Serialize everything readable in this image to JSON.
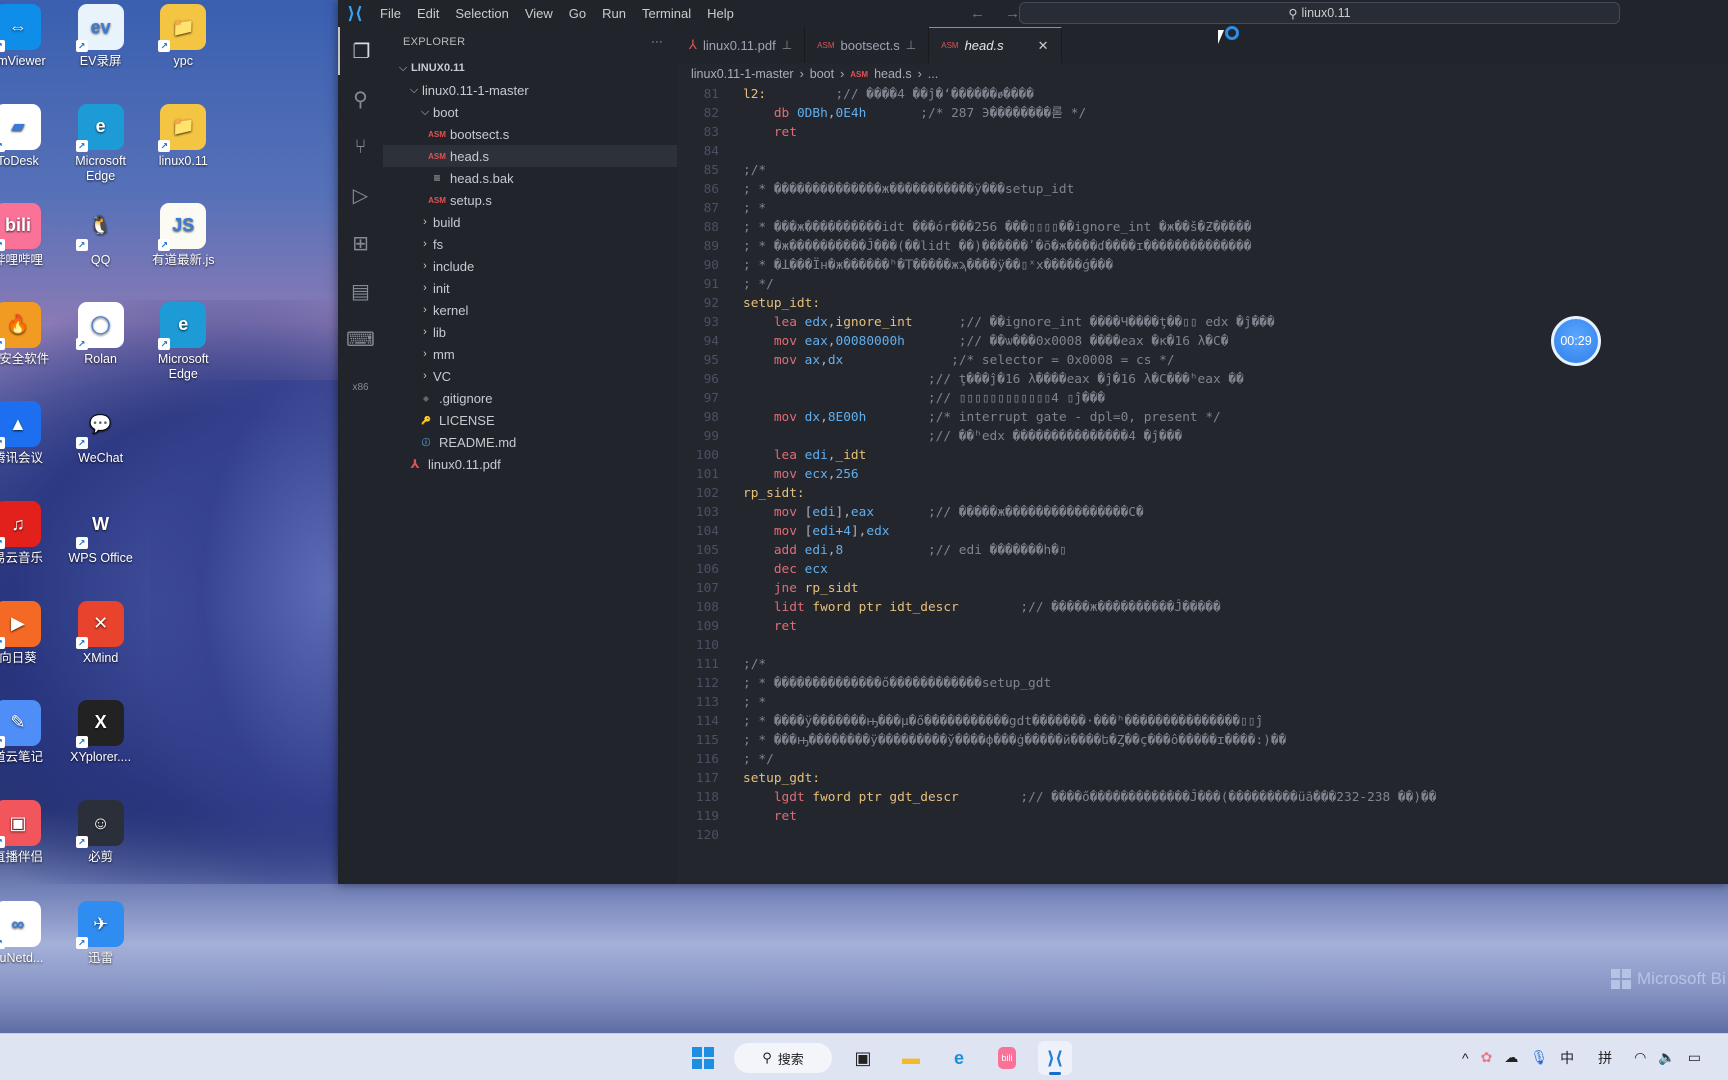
{
  "desktop": {
    "icons": [
      {
        "label": "amViewer",
        "glyph": "⇔",
        "bg": "#0e8ee9",
        "col": 0,
        "row": 0
      },
      {
        "label": "EV录屏",
        "glyph": "ev",
        "bg": "#e9f3fb",
        "col": 1,
        "row": 0
      },
      {
        "label": "ypc",
        "glyph": "📁",
        "bg": "#f4c542",
        "col": 2,
        "row": 0
      },
      {
        "label": "ToDesk",
        "glyph": "▰",
        "bg": "#ffffff",
        "col": 0,
        "row": 1
      },
      {
        "label": "Microsoft Edge",
        "glyph": "e",
        "bg": "#1d9bd7",
        "col": 1,
        "row": 1
      },
      {
        "label": "linux0.11",
        "glyph": "📁",
        "bg": "#f4c542",
        "col": 2,
        "row": 1
      },
      {
        "label": "哔哩哔哩",
        "glyph": "bili",
        "bg": "#fb7299",
        "col": 0,
        "row": 2
      },
      {
        "label": "QQ",
        "glyph": "🐧",
        "bg": "transparent",
        "col": 1,
        "row": 2
      },
      {
        "label": "有道最新.js",
        "glyph": "JS",
        "bg": "#fbfbf3",
        "col": 2,
        "row": 2
      },
      {
        "label": "戒安全软件",
        "glyph": "🔥",
        "bg": "#f29b22",
        "col": 0,
        "row": 3
      },
      {
        "label": "Rolan",
        "glyph": "◯",
        "bg": "#ffffff",
        "col": 1,
        "row": 3
      },
      {
        "label": "Microsoft Edge",
        "glyph": "e",
        "bg": "#1d9bd7",
        "col": 2,
        "row": 3
      },
      {
        "label": "腾讯会议",
        "glyph": "▲",
        "bg": "#1e6ff0",
        "col": 0,
        "row": 4
      },
      {
        "label": "WeChat",
        "glyph": "💬",
        "bg": "transparent",
        "col": 1,
        "row": 4
      },
      {
        "label": "易云音乐",
        "glyph": "♫",
        "bg": "#e2211c",
        "col": 0,
        "row": 5
      },
      {
        "label": "WPS Office",
        "glyph": "W",
        "bg": "transparent",
        "col": 1,
        "row": 5
      },
      {
        "label": "向日葵",
        "glyph": "▶",
        "bg": "#f46a24",
        "col": 0,
        "row": 6
      },
      {
        "label": "XMind",
        "glyph": "✕",
        "bg": "#e8432c",
        "col": 1,
        "row": 6
      },
      {
        "label": "道云笔记",
        "glyph": "✎",
        "bg": "#4f8ef7",
        "col": 0,
        "row": 7
      },
      {
        "label": "XYplorer....",
        "glyph": "X",
        "bg": "#222222",
        "col": 1,
        "row": 7
      },
      {
        "label": "直播伴侣",
        "glyph": "▣",
        "bg": "#f2565c",
        "col": 0,
        "row": 8
      },
      {
        "label": "必剪",
        "glyph": "☺",
        "bg": "#2b2f3a",
        "col": 1,
        "row": 8
      },
      {
        "label": "duNetd...",
        "glyph": "∞",
        "bg": "#ffffff",
        "col": 0,
        "row": 9
      },
      {
        "label": "迅雷",
        "glyph": "✈",
        "bg": "#2f8cf0",
        "col": 1,
        "row": 9
      }
    ],
    "watermark": "Microsoft Bi"
  },
  "vscode": {
    "menu": [
      "File",
      "Edit",
      "Selection",
      "View",
      "Go",
      "Run",
      "Terminal",
      "Help"
    ],
    "nav_arrows": "← →",
    "command_center": "linux0.11",
    "activity_bar": [
      "explorer-icon",
      "search-icon",
      "source-control-icon",
      "run-debug-icon",
      "extensions-icon",
      "notebook-icon",
      "terminal-icon",
      "x86-icon"
    ],
    "sidebar": {
      "title": "EXPLORER",
      "more": "···",
      "tree": [
        {
          "label": "LINUX0.11",
          "type": "root",
          "depth": 0,
          "expanded": true
        },
        {
          "label": "linux0.11-1-master",
          "type": "folder",
          "depth": 1,
          "expanded": true
        },
        {
          "label": "boot",
          "type": "folder",
          "depth": 2,
          "expanded": true
        },
        {
          "label": "bootsect.s",
          "type": "asm",
          "depth": 3
        },
        {
          "label": "head.s",
          "type": "asm",
          "depth": 3,
          "selected": true
        },
        {
          "label": "head.s.bak",
          "type": "text",
          "depth": 3
        },
        {
          "label": "setup.s",
          "type": "asm",
          "depth": 3
        },
        {
          "label": "build",
          "type": "folder",
          "depth": 2,
          "expanded": false
        },
        {
          "label": "fs",
          "type": "folder",
          "depth": 2,
          "expanded": false
        },
        {
          "label": "include",
          "type": "folder",
          "depth": 2,
          "expanded": false
        },
        {
          "label": "init",
          "type": "folder",
          "depth": 2,
          "expanded": false
        },
        {
          "label": "kernel",
          "type": "folder",
          "depth": 2,
          "expanded": false
        },
        {
          "label": "lib",
          "type": "folder",
          "depth": 2,
          "expanded": false
        },
        {
          "label": "mm",
          "type": "folder",
          "depth": 2,
          "expanded": false
        },
        {
          "label": "VC",
          "type": "folder",
          "depth": 2,
          "expanded": false
        },
        {
          "label": ".gitignore",
          "type": "git",
          "depth": 2
        },
        {
          "label": "LICENSE",
          "type": "license",
          "depth": 2
        },
        {
          "label": "README.md",
          "type": "info",
          "depth": 2
        },
        {
          "label": "linux0.11.pdf",
          "type": "pdf",
          "depth": 1
        }
      ]
    },
    "tabs": [
      {
        "label": "linux0.11.pdf",
        "icon": "pdf",
        "pinned": true,
        "active": false
      },
      {
        "label": "bootsect.s",
        "icon": "asm",
        "pinned": true,
        "active": false
      },
      {
        "label": "head.s",
        "icon": "asm",
        "pinned": false,
        "active": true
      }
    ],
    "breadcrumb": [
      "linux0.11-1-master",
      "boot",
      "head.s",
      "..."
    ],
    "code": [
      {
        "n": 81,
        "t": [
          [
            "lbl",
            "l2:"
          ],
          [
            "pn",
            "         "
          ],
          [
            "cm",
            ";// ����4 ��ĵ�‘������ꬾ����"
          ]
        ]
      },
      {
        "n": 82,
        "t": [
          [
            "pn",
            "    "
          ],
          [
            "kw",
            "db"
          ],
          [
            "pn",
            " "
          ],
          [
            "num2",
            "0DBh"
          ],
          [
            "pn",
            ","
          ],
          [
            "num2",
            "0E4h"
          ],
          [
            "pn",
            "       "
          ],
          [
            "cm",
            ";/* 287 Э��������롣 */"
          ]
        ]
      },
      {
        "n": 83,
        "t": [
          [
            "pn",
            "    "
          ],
          [
            "kw",
            "ret"
          ]
        ]
      },
      {
        "n": 84,
        "t": []
      },
      {
        "n": 85,
        "t": [
          [
            "cm",
            ";/*"
          ]
        ]
      },
      {
        "n": 86,
        "t": [
          [
            "cm",
            "; * ��������������ж�����������ÿ���setup_idt"
          ]
        ]
      },
      {
        "n": 87,
        "t": [
          [
            "cm",
            "; *"
          ]
        ]
      },
      {
        "n": 88,
        "t": [
          [
            "cm",
            "; * ���ж����������idt ���ór���256 ���▯▯▯▯��ignore_int �ж��š�Ƶ�����"
          ]
        ]
      },
      {
        "n": 89,
        "t": [
          [
            "cm",
            "; * �ж����������Ĵ���(��lidt ��)������ʹ�õ�ж����ɗ����ɪ��������������"
          ]
        ]
      },
      {
        "n": 90,
        "t": [
          [
            "cm",
            "; * �ꓕ���Ïн�ж������ʰ�ꓔ�����жϡ����ÿ��▯ˣх�����ǵ���"
          ]
        ]
      },
      {
        "n": 91,
        "t": [
          [
            "cm",
            "; */"
          ]
        ]
      },
      {
        "n": 92,
        "t": [
          [
            "lbl",
            "setup_idt:"
          ]
        ]
      },
      {
        "n": 93,
        "t": [
          [
            "pn",
            "    "
          ],
          [
            "kw",
            "lea"
          ],
          [
            "pn",
            " "
          ],
          [
            "reg",
            "edx"
          ],
          [
            "pn",
            ","
          ],
          [
            "id",
            "ignore_int"
          ],
          [
            "pn",
            "      "
          ],
          [
            "cm",
            ";// ��ignore_int ����Ч����ţ��▯▯ edx �ĵ���"
          ]
        ]
      },
      {
        "n": 94,
        "t": [
          [
            "pn",
            "    "
          ],
          [
            "kw",
            "mov"
          ],
          [
            "pn",
            " "
          ],
          [
            "reg",
            "eax"
          ],
          [
            "pn",
            ","
          ],
          [
            "num2",
            "00080000h"
          ],
          [
            "pn",
            "       "
          ],
          [
            "cm",
            ";// ��ѡ���0x0008 ����eax �ĸ�16 λ�С�"
          ]
        ]
      },
      {
        "n": 95,
        "t": [
          [
            "pn",
            "    "
          ],
          [
            "kw",
            "mov"
          ],
          [
            "pn",
            " "
          ],
          [
            "reg",
            "ax"
          ],
          [
            "pn",
            ","
          ],
          [
            "reg",
            "dx"
          ],
          [
            "pn",
            "              "
          ],
          [
            "cm",
            ";/* selector = 0x0008 = cs */"
          ]
        ]
      },
      {
        "n": 96,
        "t": [
          [
            "pn",
            "                        "
          ],
          [
            "cm",
            ";// ţ���ĵ�16 λ����eax �ĵ�16 λ�С���ʰeax ��"
          ]
        ]
      },
      {
        "n": 97,
        "t": [
          [
            "pn",
            "                        "
          ],
          [
            "cm",
            ";// ▯▯▯▯▯▯▯▯▯▯▯▯4 ▯ĵ���"
          ]
        ]
      },
      {
        "n": 98,
        "t": [
          [
            "pn",
            "    "
          ],
          [
            "kw",
            "mov"
          ],
          [
            "pn",
            " "
          ],
          [
            "reg",
            "dx"
          ],
          [
            "pn",
            ","
          ],
          [
            "num2",
            "8E00h"
          ],
          [
            "pn",
            "        "
          ],
          [
            "cm",
            ";/* interrupt gate - dpl=0, present */"
          ]
        ]
      },
      {
        "n": 99,
        "t": [
          [
            "pn",
            "                        "
          ],
          [
            "cm",
            ";// ��ʰedx ���������������4 �ĵ���"
          ]
        ]
      },
      {
        "n": 100,
        "t": [
          [
            "pn",
            "    "
          ],
          [
            "kw",
            "lea"
          ],
          [
            "pn",
            " "
          ],
          [
            "reg",
            "edi"
          ],
          [
            "pn",
            ","
          ],
          [
            "id",
            "_idt"
          ]
        ]
      },
      {
        "n": 101,
        "t": [
          [
            "pn",
            "    "
          ],
          [
            "kw",
            "mov"
          ],
          [
            "pn",
            " "
          ],
          [
            "reg",
            "ecx"
          ],
          [
            "pn",
            ","
          ],
          [
            "num2",
            "256"
          ]
        ]
      },
      {
        "n": 102,
        "t": [
          [
            "lbl",
            "rp_sidt:"
          ]
        ]
      },
      {
        "n": 103,
        "t": [
          [
            "pn",
            "    "
          ],
          [
            "kw",
            "mov"
          ],
          [
            "pn",
            " ["
          ],
          [
            "reg",
            "edi"
          ],
          [
            "pn",
            "],"
          ],
          [
            "reg",
            "eax"
          ],
          [
            "pn",
            "       "
          ],
          [
            "cm",
            ";// �����ж����������������С�"
          ]
        ]
      },
      {
        "n": 104,
        "t": [
          [
            "pn",
            "    "
          ],
          [
            "kw",
            "mov"
          ],
          [
            "pn",
            " ["
          ],
          [
            "reg",
            "edi"
          ],
          [
            "pn",
            "+"
          ],
          [
            "num2",
            "4"
          ],
          [
            "pn",
            "],"
          ],
          [
            "reg",
            "edx"
          ]
        ]
      },
      {
        "n": 105,
        "t": [
          [
            "pn",
            "    "
          ],
          [
            "kw",
            "add"
          ],
          [
            "pn",
            " "
          ],
          [
            "reg",
            "edi"
          ],
          [
            "pn",
            ","
          ],
          [
            "num2",
            "8"
          ],
          [
            "pn",
            "           "
          ],
          [
            "cm",
            ";// edi �������һ�▯"
          ]
        ]
      },
      {
        "n": 106,
        "t": [
          [
            "pn",
            "    "
          ],
          [
            "kw",
            "dec"
          ],
          [
            "pn",
            " "
          ],
          [
            "reg",
            "ecx"
          ]
        ]
      },
      {
        "n": 107,
        "t": [
          [
            "pn",
            "    "
          ],
          [
            "kw",
            "jne"
          ],
          [
            "pn",
            " "
          ],
          [
            "id",
            "rp_sidt"
          ]
        ]
      },
      {
        "n": 108,
        "t": [
          [
            "pn",
            "    "
          ],
          [
            "kw",
            "lidt"
          ],
          [
            "pn",
            " "
          ],
          [
            "id",
            "fword ptr idt_descr"
          ],
          [
            "pn",
            "        "
          ],
          [
            "cm",
            ";// �����ж����������Ĵ�����"
          ]
        ]
      },
      {
        "n": 109,
        "t": [
          [
            "pn",
            "    "
          ],
          [
            "kw",
            "ret"
          ]
        ]
      },
      {
        "n": 110,
        "t": []
      },
      {
        "n": 111,
        "t": [
          [
            "cm",
            ";/*"
          ]
        ]
      },
      {
        "n": 112,
        "t": [
          [
            "cm",
            "; * ��������������ő������������setup_gdt"
          ]
        ]
      },
      {
        "n": 113,
        "t": [
          [
            "cm",
            "; *"
          ]
        ]
      },
      {
        "n": 114,
        "t": [
          [
            "cm",
            "; * ����ÿ�������ԣ���µ�ő�����������gdt�������·���ʰ���������������▯▯ĵ"
          ]
        ]
      },
      {
        "n": 115,
        "t": [
          [
            "cm",
            "; * ���ԣ��������ÿ���������ў����ф���ġ�����й����ե�Ȥ��ç���ô�����ɪ����:)��"
          ]
        ]
      },
      {
        "n": 116,
        "t": [
          [
            "cm",
            "; */"
          ]
        ]
      },
      {
        "n": 117,
        "t": [
          [
            "lbl",
            "setup_gdt:"
          ]
        ]
      },
      {
        "n": 118,
        "t": [
          [
            "pn",
            "    "
          ],
          [
            "kw",
            "lgdt"
          ],
          [
            "pn",
            " "
          ],
          [
            "id",
            "fword ptr gdt_descr"
          ],
          [
            "pn",
            "        "
          ],
          [
            "cm",
            ";// ����ő�������������Ĵ���(���������üã���232-238 ��)��"
          ]
        ]
      },
      {
        "n": 119,
        "t": [
          [
            "pn",
            "    "
          ],
          [
            "kw",
            "ret"
          ]
        ]
      },
      {
        "n": 120,
        "t": []
      }
    ],
    "timer": "00:29"
  },
  "taskbar": {
    "search_label": "搜索",
    "apps": [
      "task-view",
      "file-explorer",
      "edge",
      "bilibili",
      "vscode"
    ],
    "tray": {
      "chevron": "^",
      "ime_mode": "中",
      "ime_name": "拼"
    }
  }
}
